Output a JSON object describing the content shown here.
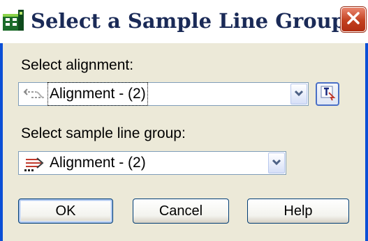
{
  "window": {
    "title": "Select a Sample Line Group",
    "icon": "civil-3d-app-icon",
    "close_icon": "close-icon"
  },
  "alignment": {
    "label": "Select alignment:",
    "selected_value": "Alignment - (2)",
    "value_icon": "alignment-icon",
    "pick_button_icon": "pick-from-drawing-icon"
  },
  "sample_line_group": {
    "label": "Select sample line group:",
    "selected_value": "Alignment - (2)",
    "value_icon": "sample-line-group-icon"
  },
  "buttons": {
    "ok": "OK",
    "cancel": "Cancel",
    "help": "Help"
  },
  "colors": {
    "title_text": "#1a2a57",
    "dialog_background": "#ece9d8",
    "frame_blue": "#0b4fd6",
    "close_red": "#c2401f"
  }
}
